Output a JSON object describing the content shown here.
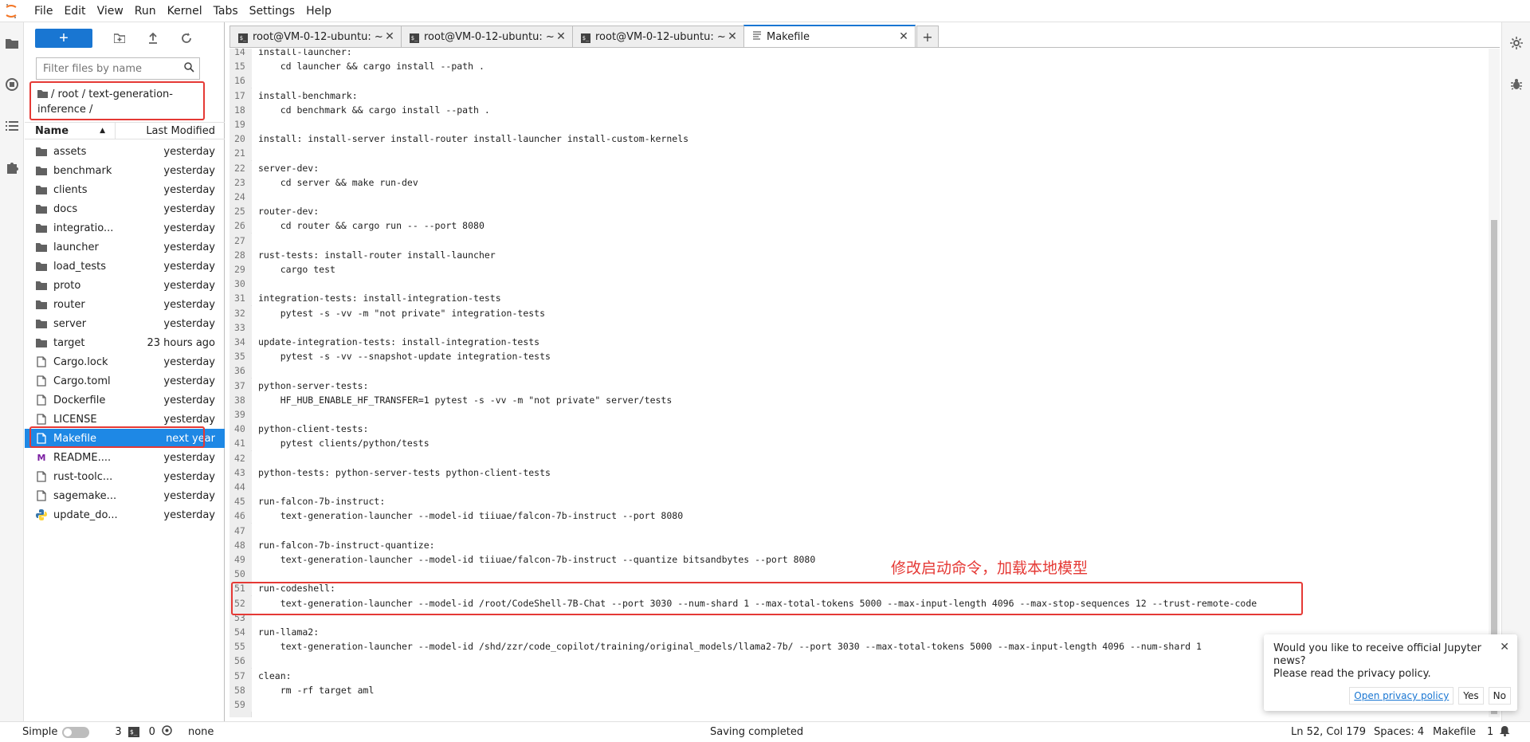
{
  "menu": [
    "File",
    "Edit",
    "View",
    "Run",
    "Kernel",
    "Tabs",
    "Settings",
    "Help"
  ],
  "filebrowser": {
    "new_label": "+",
    "filter_placeholder": "Filter files by name",
    "breadcrumb": "/ root / text-generation-inference /",
    "col_name": "Name",
    "col_modified": "Last Modified",
    "files": [
      {
        "name": "assets",
        "modified": "yesterday",
        "icon": "folder-icon"
      },
      {
        "name": "benchmark",
        "modified": "yesterday",
        "icon": "folder-icon"
      },
      {
        "name": "clients",
        "modified": "yesterday",
        "icon": "folder-icon"
      },
      {
        "name": "docs",
        "modified": "yesterday",
        "icon": "folder-icon"
      },
      {
        "name": "integratio...",
        "modified": "yesterday",
        "icon": "folder-icon"
      },
      {
        "name": "launcher",
        "modified": "yesterday",
        "icon": "folder-icon"
      },
      {
        "name": "load_tests",
        "modified": "yesterday",
        "icon": "folder-icon"
      },
      {
        "name": "proto",
        "modified": "yesterday",
        "icon": "folder-icon"
      },
      {
        "name": "router",
        "modified": "yesterday",
        "icon": "folder-icon"
      },
      {
        "name": "server",
        "modified": "yesterday",
        "icon": "folder-icon"
      },
      {
        "name": "target",
        "modified": "23 hours ago",
        "icon": "folder-icon"
      },
      {
        "name": "Cargo.lock",
        "modified": "yesterday",
        "icon": "file-icon"
      },
      {
        "name": "Cargo.toml",
        "modified": "yesterday",
        "icon": "file-icon"
      },
      {
        "name": "Dockerfile",
        "modified": "yesterday",
        "icon": "file-icon"
      },
      {
        "name": "LICENSE",
        "modified": "yesterday",
        "icon": "file-icon"
      },
      {
        "name": "Makefile",
        "modified": "next year",
        "icon": "file-icon",
        "selected": true
      },
      {
        "name": "README....",
        "modified": "yesterday",
        "icon": "markdown-icon"
      },
      {
        "name": "rust-toolc...",
        "modified": "yesterday",
        "icon": "file-icon"
      },
      {
        "name": "sagemake...",
        "modified": "yesterday",
        "icon": "file-icon"
      },
      {
        "name": "update_do...",
        "modified": "yesterday",
        "icon": "python-icon"
      }
    ]
  },
  "tabs": [
    {
      "label": "root@VM-0-12-ubuntu: ~",
      "icon": "terminal-icon"
    },
    {
      "label": "root@VM-0-12-ubuntu: ~",
      "icon": "terminal-icon"
    },
    {
      "label": "root@VM-0-12-ubuntu: ~,",
      "icon": "terminal-icon"
    },
    {
      "label": "Makefile",
      "icon": "text-file-icon",
      "active": true
    }
  ],
  "code": [
    {
      "n": "14",
      "t": "install-launcher:"
    },
    {
      "n": "15",
      "t": "    cd launcher && cargo install --path ."
    },
    {
      "n": "16",
      "t": ""
    },
    {
      "n": "17",
      "t": "install-benchmark:"
    },
    {
      "n": "18",
      "t": "    cd benchmark && cargo install --path ."
    },
    {
      "n": "19",
      "t": ""
    },
    {
      "n": "20",
      "t": "install: install-server install-router install-launcher install-custom-kernels"
    },
    {
      "n": "21",
      "t": ""
    },
    {
      "n": "22",
      "t": "server-dev:"
    },
    {
      "n": "23",
      "t": "    cd server && make run-dev"
    },
    {
      "n": "24",
      "t": ""
    },
    {
      "n": "25",
      "t": "router-dev:"
    },
    {
      "n": "26",
      "t": "    cd router && cargo run -- --port 8080"
    },
    {
      "n": "27",
      "t": ""
    },
    {
      "n": "28",
      "t": "rust-tests: install-router install-launcher"
    },
    {
      "n": "29",
      "t": "    cargo test"
    },
    {
      "n": "30",
      "t": ""
    },
    {
      "n": "31",
      "t": "integration-tests: install-integration-tests"
    },
    {
      "n": "32",
      "t": "    pytest -s -vv -m \"not private\" integration-tests"
    },
    {
      "n": "33",
      "t": ""
    },
    {
      "n": "34",
      "t": "update-integration-tests: install-integration-tests"
    },
    {
      "n": "35",
      "t": "    pytest -s -vv --snapshot-update integration-tests"
    },
    {
      "n": "36",
      "t": ""
    },
    {
      "n": "37",
      "t": "python-server-tests:"
    },
    {
      "n": "38",
      "t": "    HF_HUB_ENABLE_HF_TRANSFER=1 pytest -s -vv -m \"not private\" server/tests"
    },
    {
      "n": "39",
      "t": ""
    },
    {
      "n": "40",
      "t": "python-client-tests:"
    },
    {
      "n": "41",
      "t": "    pytest clients/python/tests"
    },
    {
      "n": "42",
      "t": ""
    },
    {
      "n": "43",
      "t": "python-tests: python-server-tests python-client-tests"
    },
    {
      "n": "44",
      "t": ""
    },
    {
      "n": "45",
      "t": "run-falcon-7b-instruct:"
    },
    {
      "n": "46",
      "t": "    text-generation-launcher --model-id tiiuae/falcon-7b-instruct --port 8080"
    },
    {
      "n": "47",
      "t": ""
    },
    {
      "n": "48",
      "t": "run-falcon-7b-instruct-quantize:"
    },
    {
      "n": "49",
      "t": "    text-generation-launcher --model-id tiiuae/falcon-7b-instruct --quantize bitsandbytes --port 8080"
    },
    {
      "n": "50",
      "t": ""
    },
    {
      "n": "51",
      "t": "run-codeshell:"
    },
    {
      "n": "52",
      "t": "    text-generation-launcher --model-id /root/CodeShell-7B-Chat --port 3030 --num-shard 1 --max-total-tokens 5000 --max-input-length 4096 --max-stop-sequences 12 --trust-remote-code"
    },
    {
      "n": "53",
      "t": ""
    },
    {
      "n": "54",
      "t": "run-llama2:"
    },
    {
      "n": "55",
      "t": "    text-generation-launcher --model-id /shd/zzr/code_copilot/training/original_models/llama2-7b/ --port 3030 --max-total-tokens 5000 --max-input-length 4096 --num-shard 1"
    },
    {
      "n": "56",
      "t": ""
    },
    {
      "n": "57",
      "t": "clean:"
    },
    {
      "n": "58",
      "t": "    rm -rf target aml"
    },
    {
      "n": "59",
      "t": ""
    }
  ],
  "annotation": "修改启动命令，加载本地模型",
  "notification": {
    "line1": "Would you like to receive official Jupyter news?",
    "line2": "Please read the privacy policy.",
    "link": "Open privacy policy",
    "yes": "Yes",
    "no": "No"
  },
  "status": {
    "mode": "Simple",
    "terminals": "3",
    "kernels": "0",
    "kernel_name": "none",
    "message": "Saving completed",
    "position": "Ln 52, Col 179",
    "spaces": "Spaces: 4",
    "filetype": "Makefile",
    "notifications": "1"
  },
  "colors": {
    "accent": "#1976d2",
    "selected": "#1e88e5",
    "annotation": "#e53935"
  }
}
